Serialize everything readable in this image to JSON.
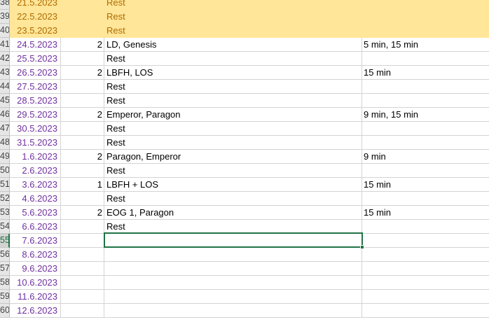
{
  "rows": [
    {
      "num": "38",
      "date": "21.5.2023",
      "count": "",
      "activity": "Rest",
      "duration": "",
      "highlight": true
    },
    {
      "num": "39",
      "date": "22.5.2023",
      "count": "",
      "activity": "Rest",
      "duration": "",
      "highlight": true
    },
    {
      "num": "40",
      "date": "23.5.2023",
      "count": "",
      "activity": "Rest",
      "duration": "",
      "highlight": true
    },
    {
      "num": "41",
      "date": "24.5.2023",
      "count": "2",
      "activity": "LD, Genesis",
      "duration": "5 min, 15 min",
      "highlight": false
    },
    {
      "num": "42",
      "date": "25.5.2023",
      "count": "",
      "activity": "Rest",
      "duration": "",
      "highlight": false
    },
    {
      "num": "43",
      "date": "26.5.2023",
      "count": "2",
      "activity": "LBFH, LOS",
      "duration": "15 min",
      "highlight": false
    },
    {
      "num": "44",
      "date": "27.5.2023",
      "count": "",
      "activity": "Rest",
      "duration": "",
      "highlight": false
    },
    {
      "num": "45",
      "date": "28.5.2023",
      "count": "",
      "activity": "Rest",
      "duration": "",
      "highlight": false
    },
    {
      "num": "46",
      "date": "29.5.2023",
      "count": "2",
      "activity": "Emperor, Paragon",
      "duration": "9 min, 15 min",
      "highlight": false
    },
    {
      "num": "47",
      "date": "30.5.2023",
      "count": "",
      "activity": "Rest",
      "duration": "",
      "highlight": false
    },
    {
      "num": "48",
      "date": "31.5.2023",
      "count": "",
      "activity": "Rest",
      "duration": "",
      "highlight": false
    },
    {
      "num": "49",
      "date": "1.6.2023",
      "count": "2",
      "activity": "Paragon, Emperor",
      "duration": "9 min",
      "highlight": false
    },
    {
      "num": "50",
      "date": "2.6.2023",
      "count": "",
      "activity": "Rest",
      "duration": "",
      "highlight": false
    },
    {
      "num": "51",
      "date": "3.6.2023",
      "count": "1",
      "activity": "LBFH + LOS",
      "duration": "15 min",
      "highlight": false
    },
    {
      "num": "52",
      "date": "4.6.2023",
      "count": "",
      "activity": "Rest",
      "duration": "",
      "highlight": false
    },
    {
      "num": "53",
      "date": "5.6.2023",
      "count": "2",
      "activity": "EOG 1, Paragon",
      "duration": "15 min",
      "highlight": false
    },
    {
      "num": "54",
      "date": "6.6.2023",
      "count": "",
      "activity": "Rest",
      "duration": "",
      "highlight": false
    },
    {
      "num": "55",
      "date": "7.6.2023",
      "count": "",
      "activity": "",
      "duration": "",
      "highlight": false,
      "selected": true
    },
    {
      "num": "56",
      "date": "8.6.2023",
      "count": "",
      "activity": "",
      "duration": "",
      "highlight": false
    },
    {
      "num": "57",
      "date": "9.6.2023",
      "count": "",
      "activity": "",
      "duration": "",
      "highlight": false
    },
    {
      "num": "58",
      "date": "10.6.2023",
      "count": "",
      "activity": "",
      "duration": "",
      "highlight": false
    },
    {
      "num": "59",
      "date": "11.6.2023",
      "count": "",
      "activity": "",
      "duration": "",
      "highlight": false
    },
    {
      "num": "60",
      "date": "12.6.2023",
      "count": "",
      "activity": "",
      "duration": "",
      "highlight": false
    }
  ],
  "colors": {
    "highlight_fill": "#ffe699",
    "highlight_text": "#b06c00",
    "date_text": "#7030a0",
    "selection_border": "#217346"
  }
}
